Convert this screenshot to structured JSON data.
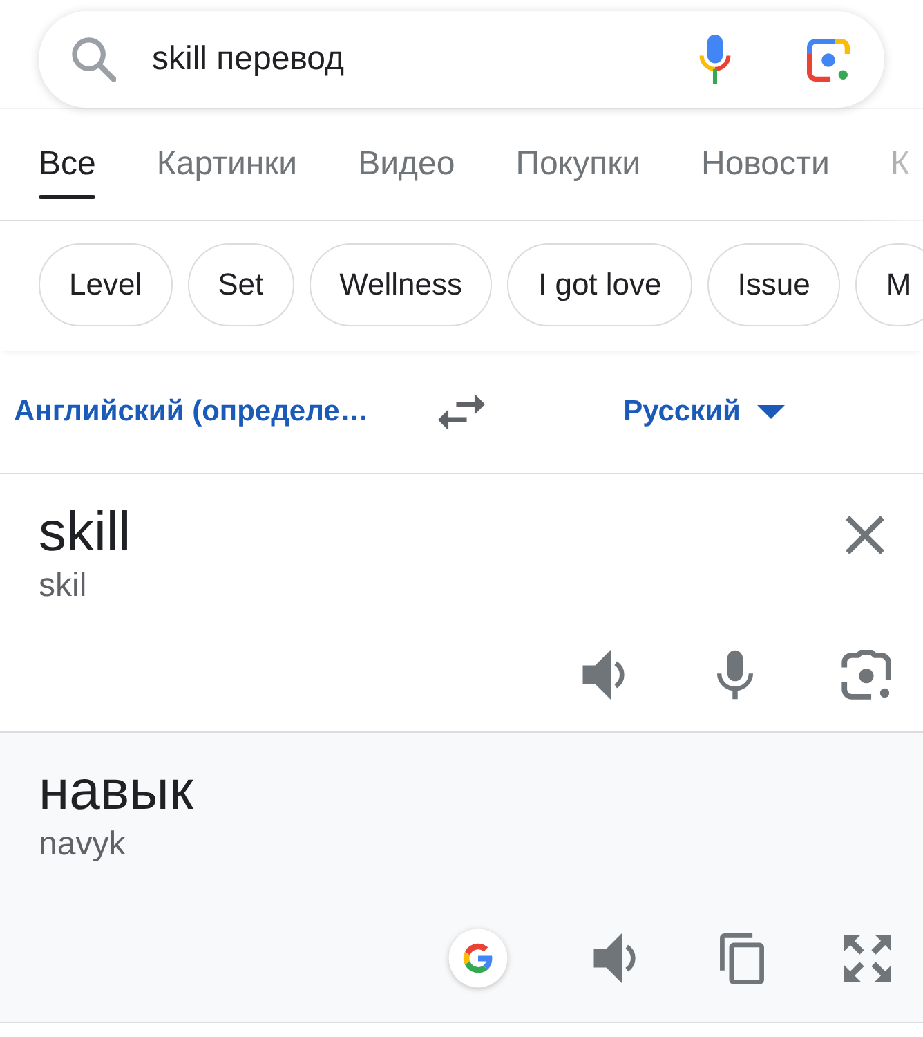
{
  "search": {
    "value": "skill перевод"
  },
  "tabs": [
    {
      "label": "Все",
      "selected": true
    },
    {
      "label": "Картинки",
      "selected": false
    },
    {
      "label": "Видео",
      "selected": false
    },
    {
      "label": "Покупки",
      "selected": false
    },
    {
      "label": "Новости",
      "selected": false
    },
    {
      "label": "К",
      "selected": false
    }
  ],
  "chips": [
    "Level",
    "Set",
    "Wellness",
    "I got love",
    "Issue",
    "M"
  ],
  "translator": {
    "source_language": "Английский (определе…",
    "target_language": "Русский",
    "source": {
      "text": "skill",
      "transliteration": "skil"
    },
    "target": {
      "text": "навык",
      "transliteration": "navyk"
    }
  }
}
